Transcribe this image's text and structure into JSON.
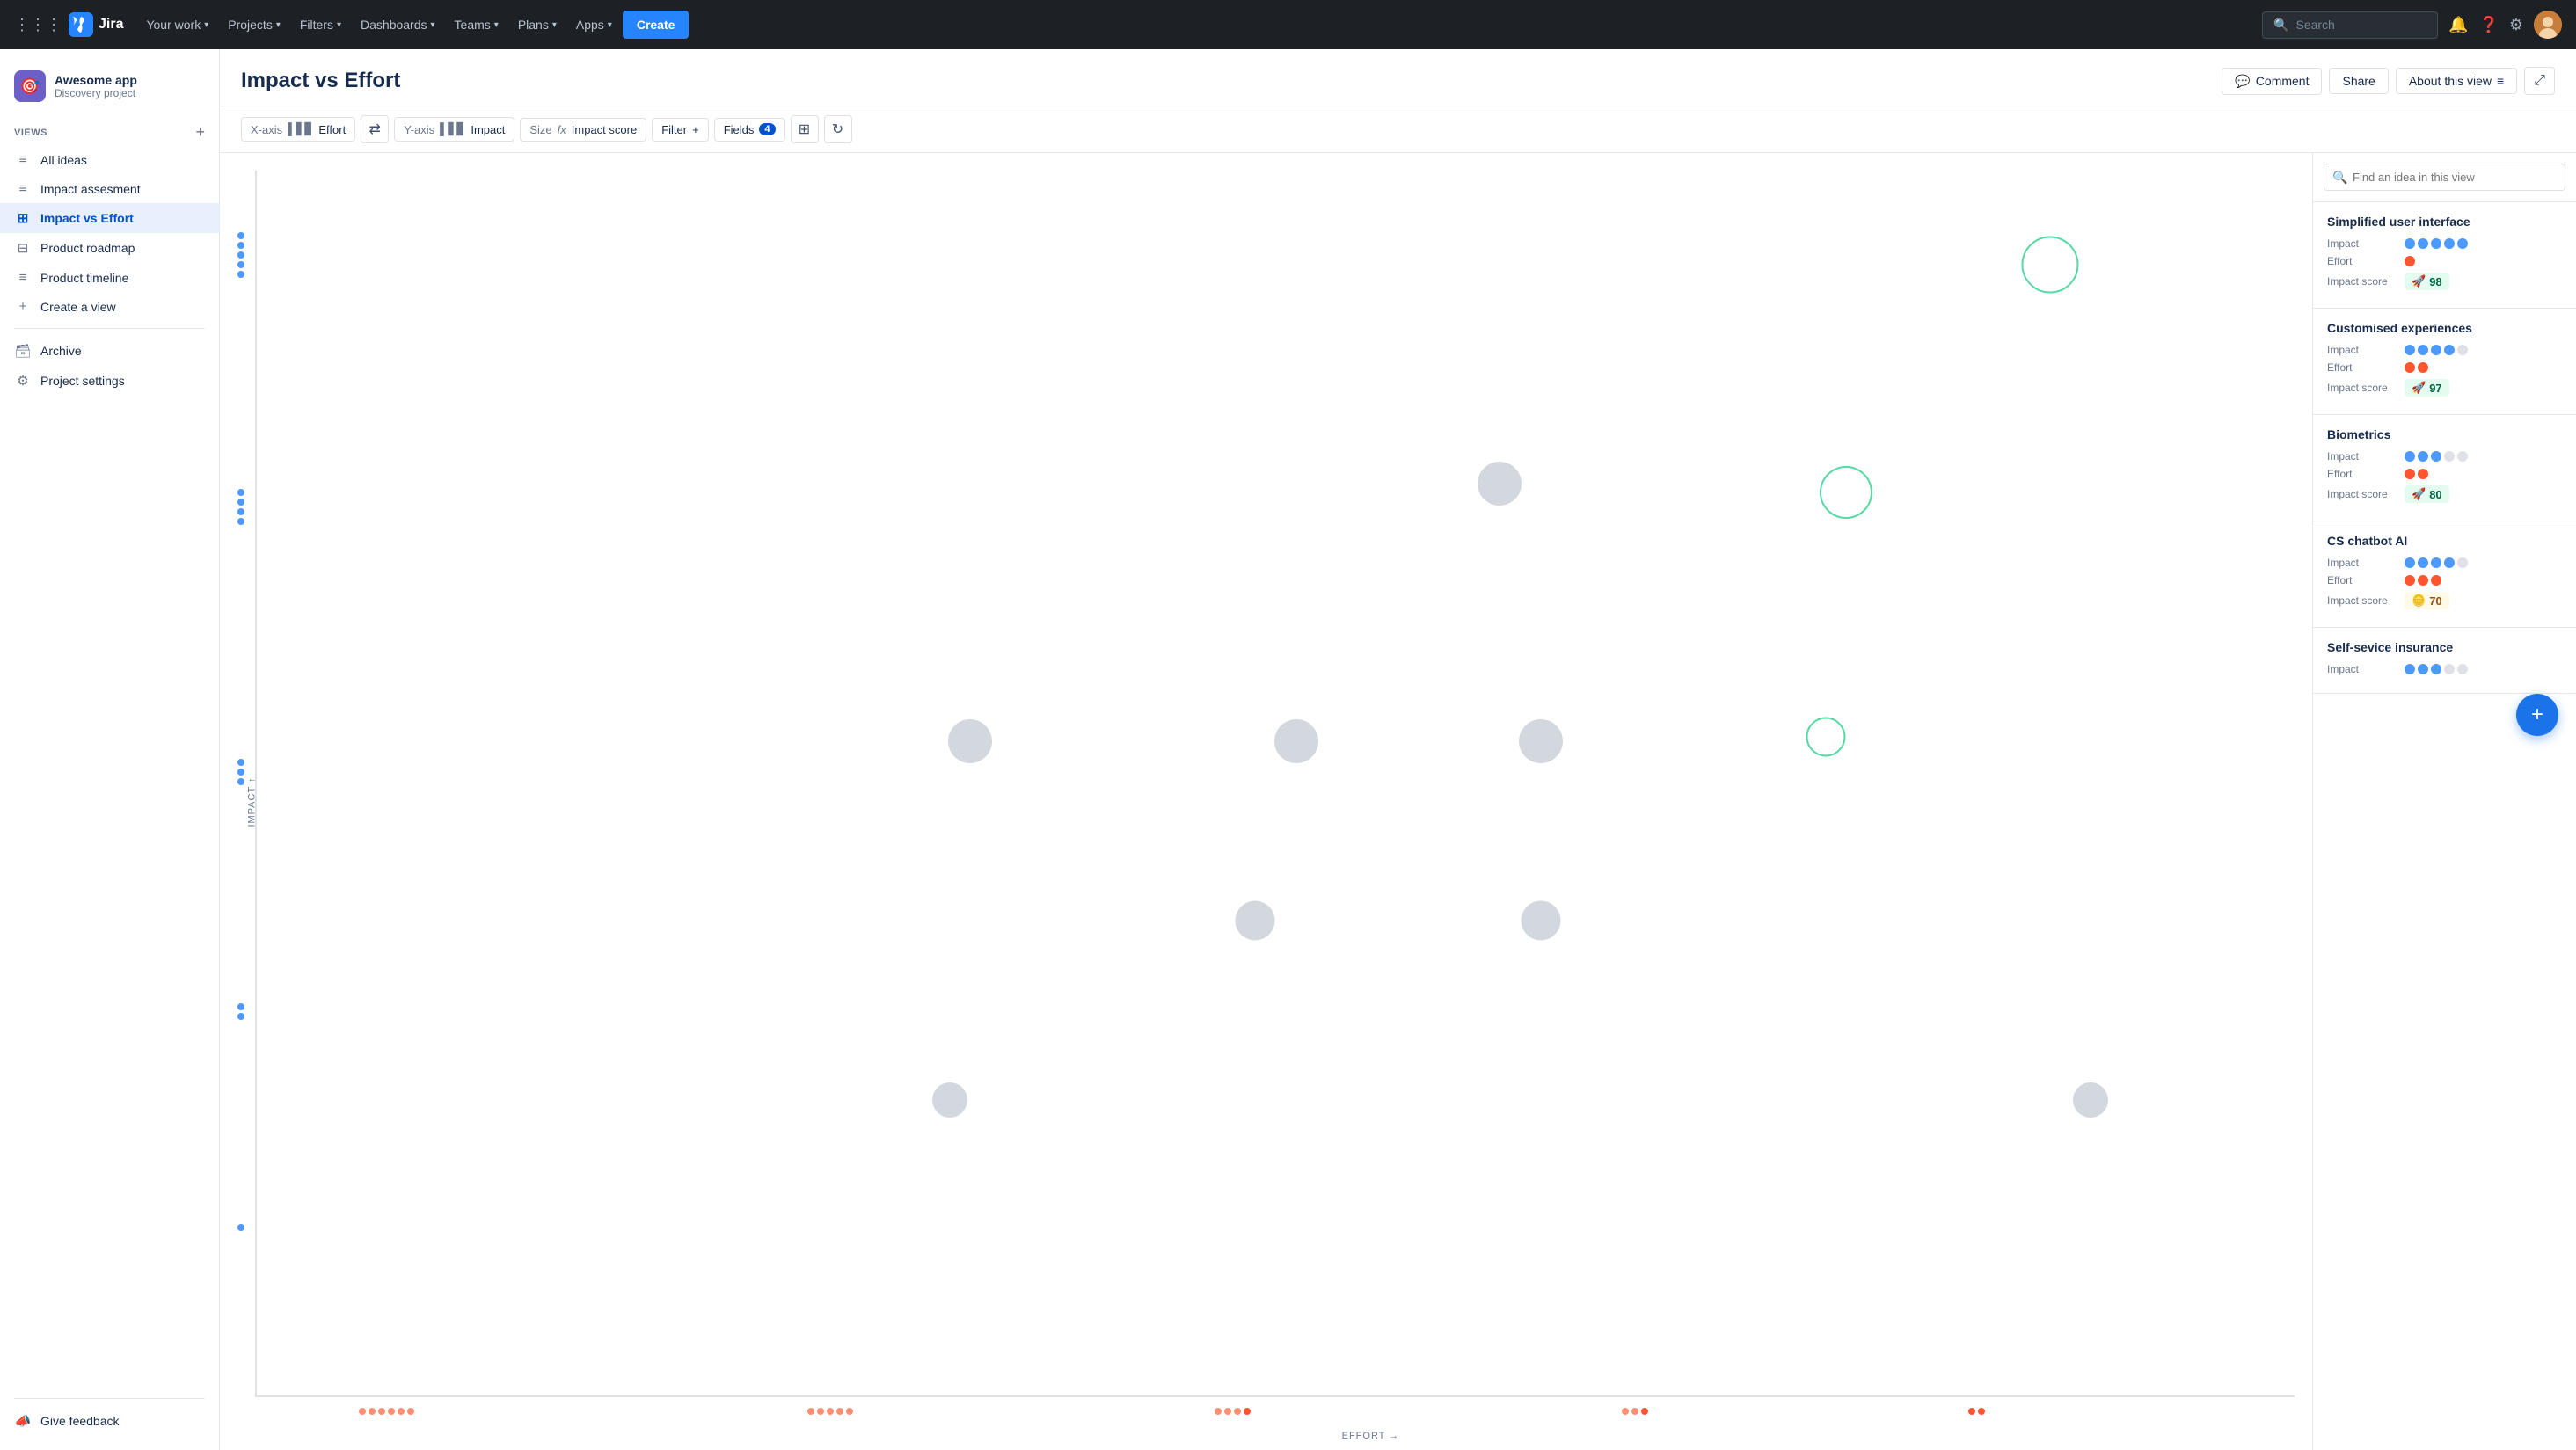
{
  "topnav": {
    "logo_text": "Jira",
    "nav_items": [
      {
        "label": "Your work",
        "has_chevron": true
      },
      {
        "label": "Projects",
        "has_chevron": true
      },
      {
        "label": "Filters",
        "has_chevron": true
      },
      {
        "label": "Dashboards",
        "has_chevron": true
      },
      {
        "label": "Teams",
        "has_chevron": true
      },
      {
        "label": "Plans",
        "has_chevron": true
      },
      {
        "label": "Apps",
        "has_chevron": true
      }
    ],
    "create_label": "Create",
    "search_placeholder": "Search"
  },
  "sidebar": {
    "project_name": "Awesome app",
    "project_type": "Discovery project",
    "views_label": "VIEWS",
    "items": [
      {
        "label": "All ideas",
        "icon": "≡",
        "active": false
      },
      {
        "label": "Impact assesment",
        "icon": "≡",
        "active": false
      },
      {
        "label": "Impact vs Effort",
        "icon": "⊞",
        "active": true
      },
      {
        "label": "Product roadmap",
        "icon": "⊟",
        "active": false
      },
      {
        "label": "Product timeline",
        "icon": "≡",
        "active": false
      },
      {
        "label": "Create a view",
        "icon": "+",
        "active": false
      }
    ],
    "archive_label": "Archive",
    "settings_label": "Project settings",
    "feedback_label": "Give feedback"
  },
  "page": {
    "title": "Impact vs Effort",
    "comment_label": "Comment",
    "share_label": "Share",
    "about_label": "About this view",
    "expand_label": "⤢"
  },
  "toolbar": {
    "xaxis_label": "X-axis",
    "xaxis_value": "Effort",
    "yaxis_label": "Y-axis",
    "yaxis_value": "Impact",
    "size_label": "Size",
    "size_value": "Impact score",
    "filter_label": "Filter",
    "fields_label": "Fields",
    "fields_count": "4"
  },
  "panel": {
    "search_placeholder": "Find an idea in this view",
    "ideas": [
      {
        "title": "Simplified user interface",
        "impact_dots": [
          1,
          1,
          1,
          1,
          1
        ],
        "effort_dots": [
          1,
          0,
          0,
          0,
          0
        ],
        "impact_score": "98",
        "score_color": "green"
      },
      {
        "title": "Customised experiences",
        "impact_dots": [
          1,
          1,
          1,
          1,
          0
        ],
        "effort_dots": [
          1,
          1,
          0,
          0,
          0
        ],
        "impact_score": "97",
        "score_color": "green"
      },
      {
        "title": "Biometrics",
        "impact_dots": [
          1,
          1,
          1,
          0,
          0
        ],
        "effort_dots": [
          1,
          1,
          0,
          0,
          0
        ],
        "impact_score": "80",
        "score_color": "green"
      },
      {
        "title": "CS chatbot AI",
        "impact_dots": [
          1,
          1,
          1,
          1,
          0
        ],
        "effort_dots": [
          1,
          1,
          1,
          0,
          0
        ],
        "impact_score": "70",
        "score_color": "yellow"
      },
      {
        "title": "Self-sevice insurance",
        "impact_dots": [
          1,
          1,
          1,
          0,
          0
        ],
        "effort_dots": [],
        "impact_score": "",
        "score_color": ""
      }
    ]
  },
  "chart": {
    "x_label": "EFFORT →",
    "y_label": "IMPACT ↑"
  }
}
